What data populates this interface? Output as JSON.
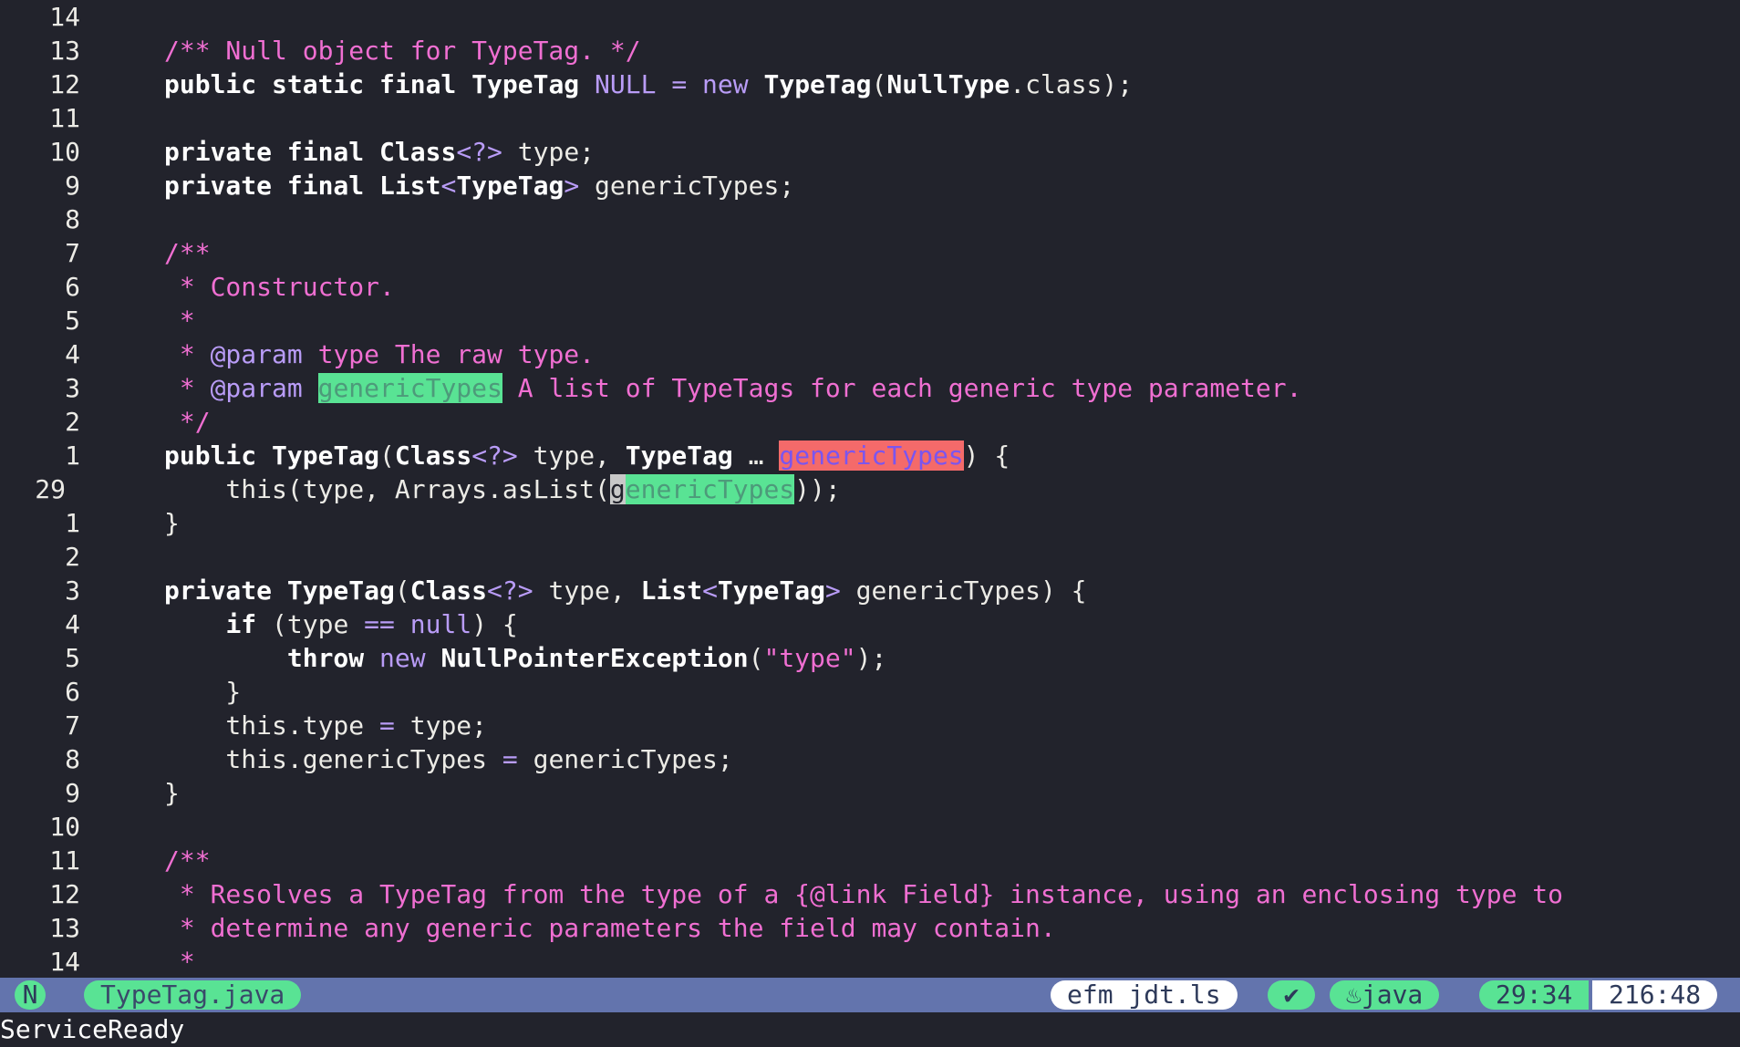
{
  "editor": {
    "lines": [
      {
        "num": "14",
        "current": false,
        "tokens": []
      },
      {
        "num": "13",
        "current": false,
        "tokens": [
          {
            "t": "/** Null object for TypeTag. */",
            "c": "t-comment",
            "n": "comment"
          }
        ]
      },
      {
        "num": "12",
        "current": false,
        "tokens": [
          {
            "t": "public static final ",
            "c": "t-kw",
            "n": "keyword"
          },
          {
            "t": "TypeTag",
            "c": "t-type",
            "n": "type-name"
          },
          {
            "t": " ",
            "c": "t-plain",
            "n": "space"
          },
          {
            "t": "NULL",
            "c": "t-const",
            "n": "constant"
          },
          {
            "t": " = ",
            "c": "t-op",
            "n": "operator"
          },
          {
            "t": "new",
            "c": "t-op",
            "n": "keyword-new"
          },
          {
            "t": " ",
            "c": "t-plain",
            "n": "space"
          },
          {
            "t": "TypeTag",
            "c": "t-type",
            "n": "type-name"
          },
          {
            "t": "(",
            "c": "t-plain",
            "n": "paren"
          },
          {
            "t": "NullType",
            "c": "t-type",
            "n": "type-name"
          },
          {
            "t": ".class);",
            "c": "t-plain",
            "n": "code-text"
          }
        ]
      },
      {
        "num": "11",
        "current": false,
        "tokens": []
      },
      {
        "num": "10",
        "current": false,
        "tokens": [
          {
            "t": "private final ",
            "c": "t-kw",
            "n": "keyword"
          },
          {
            "t": "Class",
            "c": "t-type",
            "n": "type-name"
          },
          {
            "t": "<?>",
            "c": "t-op",
            "n": "generic"
          },
          {
            "t": " type;",
            "c": "t-plain",
            "n": "code-text"
          }
        ]
      },
      {
        "num": "9",
        "current": false,
        "tokens": [
          {
            "t": "private final ",
            "c": "t-kw",
            "n": "keyword"
          },
          {
            "t": "List",
            "c": "t-type",
            "n": "type-name"
          },
          {
            "t": "<",
            "c": "t-op",
            "n": "generic"
          },
          {
            "t": "TypeTag",
            "c": "t-type",
            "n": "type-name"
          },
          {
            "t": ">",
            "c": "t-op",
            "n": "generic"
          },
          {
            "t": " genericTypes;",
            "c": "t-plain",
            "n": "code-text"
          }
        ]
      },
      {
        "num": "8",
        "current": false,
        "tokens": []
      },
      {
        "num": "7",
        "current": false,
        "tokens": [
          {
            "t": "/**",
            "c": "t-comment",
            "n": "comment"
          }
        ]
      },
      {
        "num": "6",
        "current": false,
        "tokens": [
          {
            "t": " * Constructor.",
            "c": "t-comment",
            "n": "comment"
          }
        ]
      },
      {
        "num": "5",
        "current": false,
        "tokens": [
          {
            "t": " *",
            "c": "t-comment",
            "n": "comment"
          }
        ]
      },
      {
        "num": "4",
        "current": false,
        "tokens": [
          {
            "t": " * ",
            "c": "t-comment",
            "n": "comment"
          },
          {
            "t": "@param",
            "c": "t-tag",
            "n": "doc-tag"
          },
          {
            "t": " type The raw type.",
            "c": "t-comment",
            "n": "comment"
          }
        ]
      },
      {
        "num": "3",
        "current": false,
        "tokens": [
          {
            "t": " * ",
            "c": "t-comment",
            "n": "comment"
          },
          {
            "t": "@param",
            "c": "t-tag",
            "n": "doc-tag"
          },
          {
            "t": " ",
            "c": "t-comment",
            "n": "comment"
          },
          {
            "t": "genericTypes",
            "c": "t-hl-green-dark",
            "n": "reference-highlight"
          },
          {
            "t": " A list of TypeTags for each generic type parameter.",
            "c": "t-comment",
            "n": "comment"
          }
        ]
      },
      {
        "num": "2",
        "current": false,
        "tokens": [
          {
            "t": " */",
            "c": "t-comment",
            "n": "comment"
          }
        ]
      },
      {
        "num": "1",
        "current": false,
        "tokens": [
          {
            "t": "public ",
            "c": "t-kw",
            "n": "keyword"
          },
          {
            "t": "TypeTag",
            "c": "t-type",
            "n": "type-name"
          },
          {
            "t": "(",
            "c": "t-plain",
            "n": "paren"
          },
          {
            "t": "Class",
            "c": "t-type",
            "n": "type-name"
          },
          {
            "t": "<?>",
            "c": "t-op",
            "n": "generic"
          },
          {
            "t": " type, ",
            "c": "t-plain",
            "n": "code-text"
          },
          {
            "t": "TypeTag",
            "c": "t-type",
            "n": "type-name"
          },
          {
            "t": " … ",
            "c": "t-plain",
            "n": "ellipsis"
          },
          {
            "t": "genericTypes",
            "c": "t-hl-red",
            "n": "definition-highlight"
          },
          {
            "t": ") {",
            "c": "t-plain",
            "n": "code-text"
          }
        ]
      },
      {
        "num": "29",
        "current": true,
        "tokens": [
          {
            "t": "    this(type, Arrays.asList(",
            "c": "t-plain",
            "n": "code-text"
          },
          {
            "t": "g",
            "c": "t-cursor",
            "n": "cursor"
          },
          {
            "t": "enericTypes",
            "c": "t-hl-green-dark",
            "n": "reference-highlight"
          },
          {
            "t": "));",
            "c": "t-plain",
            "n": "code-text"
          }
        ]
      },
      {
        "num": "1",
        "current": false,
        "tokens": [
          {
            "t": "}",
            "c": "t-plain",
            "n": "code-text"
          }
        ]
      },
      {
        "num": "2",
        "current": false,
        "tokens": []
      },
      {
        "num": "3",
        "current": false,
        "tokens": [
          {
            "t": "private ",
            "c": "t-kw",
            "n": "keyword"
          },
          {
            "t": "TypeTag",
            "c": "t-type",
            "n": "type-name"
          },
          {
            "t": "(",
            "c": "t-plain",
            "n": "paren"
          },
          {
            "t": "Class",
            "c": "t-type",
            "n": "type-name"
          },
          {
            "t": "<?>",
            "c": "t-op",
            "n": "generic"
          },
          {
            "t": " type, ",
            "c": "t-plain",
            "n": "code-text"
          },
          {
            "t": "List",
            "c": "t-type",
            "n": "type-name"
          },
          {
            "t": "<",
            "c": "t-op",
            "n": "generic"
          },
          {
            "t": "TypeTag",
            "c": "t-type",
            "n": "type-name"
          },
          {
            "t": ">",
            "c": "t-op",
            "n": "generic"
          },
          {
            "t": " genericTypes) {",
            "c": "t-plain",
            "n": "code-text"
          }
        ]
      },
      {
        "num": "4",
        "current": false,
        "tokens": [
          {
            "t": "    ",
            "c": "t-plain",
            "n": "indent"
          },
          {
            "t": "if",
            "c": "t-kw",
            "n": "keyword"
          },
          {
            "t": " (type ",
            "c": "t-plain",
            "n": "code-text"
          },
          {
            "t": "==",
            "c": "t-op",
            "n": "operator"
          },
          {
            "t": " ",
            "c": "t-plain",
            "n": "space"
          },
          {
            "t": "null",
            "c": "t-const",
            "n": "constant"
          },
          {
            "t": ") {",
            "c": "t-plain",
            "n": "code-text"
          }
        ]
      },
      {
        "num": "5",
        "current": false,
        "tokens": [
          {
            "t": "        ",
            "c": "t-plain",
            "n": "indent"
          },
          {
            "t": "throw",
            "c": "t-kw",
            "n": "keyword"
          },
          {
            "t": " ",
            "c": "t-plain",
            "n": "space"
          },
          {
            "t": "new",
            "c": "t-op",
            "n": "keyword-new"
          },
          {
            "t": " ",
            "c": "t-plain",
            "n": "space"
          },
          {
            "t": "NullPointerException",
            "c": "t-type",
            "n": "type-name"
          },
          {
            "t": "(",
            "c": "t-plain",
            "n": "paren"
          },
          {
            "t": "\"type\"",
            "c": "t-str",
            "n": "string"
          },
          {
            "t": ");",
            "c": "t-plain",
            "n": "code-text"
          }
        ]
      },
      {
        "num": "6",
        "current": false,
        "tokens": [
          {
            "t": "    }",
            "c": "t-plain",
            "n": "code-text"
          }
        ]
      },
      {
        "num": "7",
        "current": false,
        "tokens": [
          {
            "t": "    this.type ",
            "c": "t-plain",
            "n": "code-text"
          },
          {
            "t": "=",
            "c": "t-op",
            "n": "operator"
          },
          {
            "t": " type;",
            "c": "t-plain",
            "n": "code-text"
          }
        ]
      },
      {
        "num": "8",
        "current": false,
        "tokens": [
          {
            "t": "    this.genericTypes ",
            "c": "t-plain",
            "n": "code-text"
          },
          {
            "t": "=",
            "c": "t-op",
            "n": "operator"
          },
          {
            "t": " genericTypes;",
            "c": "t-plain",
            "n": "code-text"
          }
        ]
      },
      {
        "num": "9",
        "current": false,
        "tokens": [
          {
            "t": "}",
            "c": "t-plain",
            "n": "code-text"
          }
        ]
      },
      {
        "num": "10",
        "current": false,
        "tokens": []
      },
      {
        "num": "11",
        "current": false,
        "tokens": [
          {
            "t": "/**",
            "c": "t-comment",
            "n": "comment"
          }
        ]
      },
      {
        "num": "12",
        "current": false,
        "tokens": [
          {
            "t": " * Resolves a TypeTag from the type of a {@link Field} instance, using an enclosing type to",
            "c": "t-comment",
            "n": "comment"
          }
        ]
      },
      {
        "num": "13",
        "current": false,
        "tokens": [
          {
            "t": " * determine any generic parameters the field may contain.",
            "c": "t-comment",
            "n": "comment"
          }
        ]
      },
      {
        "num": "14",
        "current": false,
        "tokens": [
          {
            "t": " *",
            "c": "t-comment",
            "n": "comment"
          }
        ]
      }
    ]
  },
  "statusline": {
    "mode": "N",
    "filename": "TypeTag.java",
    "lsp_clients": "efm jdt.ls",
    "diagnostics_icon": "✔",
    "language_icon": "java-icon",
    "language": "java",
    "cursor_position": "29:34",
    "total": "216:48"
  },
  "cmdline": {
    "message": "ServiceReady"
  }
}
